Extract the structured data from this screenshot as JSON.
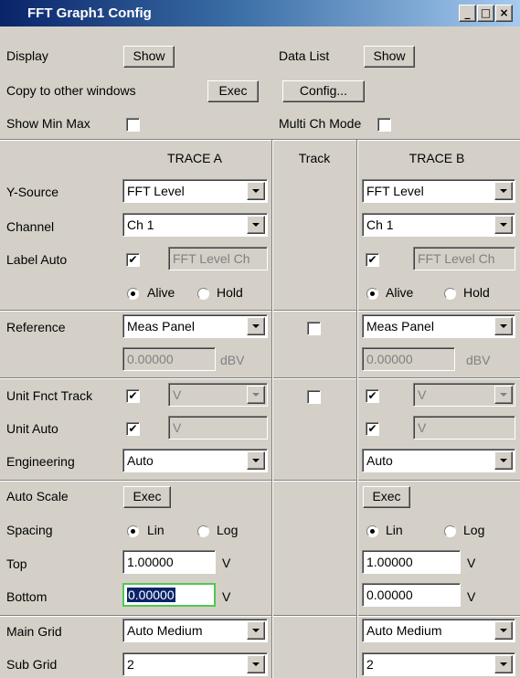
{
  "window": {
    "title": "FFT Graph1 Config",
    "buttons": {
      "minimize": "_",
      "maximize": "□",
      "close": "×"
    }
  },
  "top": {
    "display_label": "Display",
    "display_button": "Show",
    "datalist_label": "Data List",
    "datalist_button": "Show",
    "copy_label": "Copy to other windows",
    "copy_button": "Exec",
    "config_button": "Config...",
    "show_minmax_label": "Show Min Max",
    "multi_ch_label": "Multi Ch Mode"
  },
  "headers": {
    "trace_a": "TRACE A",
    "track": "Track",
    "trace_b": "TRACE B"
  },
  "labels": {
    "y_source": "Y-Source",
    "channel": "Channel",
    "label_auto": "Label Auto",
    "reference": "Reference",
    "unit_fnct_track": "Unit Fnct Track",
    "unit_auto": "Unit Auto",
    "engineering": "Engineering",
    "auto_scale": "Auto Scale",
    "spacing": "Spacing",
    "top": "Top",
    "bottom": "Bottom",
    "main_grid": "Main Grid",
    "sub_grid": "Sub Grid"
  },
  "trace_a": {
    "y_source": "FFT Level",
    "channel": "Ch 1",
    "label_auto_checked": "✔",
    "label_text": "FFT Level Ch",
    "alive": "Alive",
    "hold": "Hold",
    "reference": "Meas Panel",
    "ref_value": "0.00000",
    "ref_unit": "dBV",
    "unit_fnct_checked": "✔",
    "unit_fnct_value": "V",
    "unit_auto_checked": "✔",
    "unit_auto_value": "V",
    "engineering": "Auto",
    "auto_scale_button": "Exec",
    "lin": "Lin",
    "log": "Log",
    "top_value": "1.00000",
    "top_unit": "V",
    "bottom_value": "0.00000",
    "bottom_unit": "V",
    "main_grid": "Auto Medium",
    "sub_grid": "2"
  },
  "trace_b": {
    "y_source": "FFT Level",
    "channel": "Ch 1",
    "label_auto_checked": "✔",
    "label_text": "FFT Level Ch",
    "alive": "Alive",
    "hold": "Hold",
    "reference": "Meas Panel",
    "ref_value": "0.00000",
    "ref_unit": "dBV",
    "unit_fnct_checked": "✔",
    "unit_fnct_value": "V",
    "unit_auto_checked": "✔",
    "unit_auto_value": "V",
    "engineering": "Auto",
    "auto_scale_button": "Exec",
    "lin": "Lin",
    "log": "Log",
    "top_value": "1.00000",
    "top_unit": "V",
    "bottom_value": "0.00000",
    "bottom_unit": "V",
    "main_grid": "Auto Medium",
    "sub_grid": "2"
  }
}
